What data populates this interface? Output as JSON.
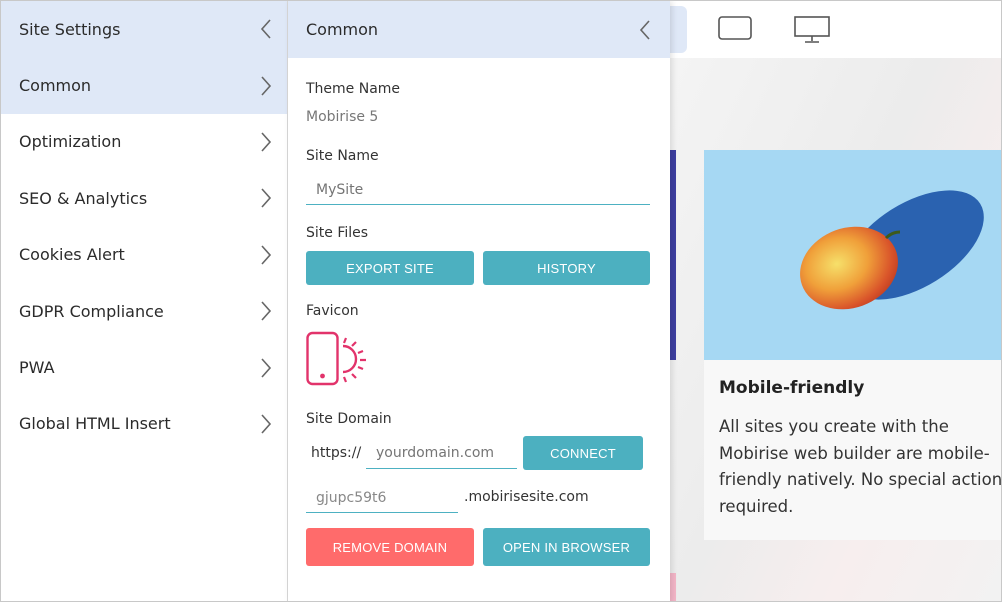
{
  "menu": {
    "header": "Site Settings",
    "items": [
      {
        "label": "Common",
        "active": true
      },
      {
        "label": "Optimization"
      },
      {
        "label": "SEO & Analytics"
      },
      {
        "label": "Cookies Alert"
      },
      {
        "label": "GDPR Compliance"
      },
      {
        "label": "PWA"
      },
      {
        "label": "Global HTML Insert"
      }
    ]
  },
  "panel": {
    "title": "Common",
    "theme_label": "Theme Name",
    "theme_value": "Mobirise 5",
    "site_name_label": "Site Name",
    "site_name_placeholder": "MySite",
    "site_files_label": "Site Files",
    "export_label": "EXPORT SITE",
    "history_label": "HISTORY",
    "favicon_label": "Favicon",
    "domain_label": "Site Domain",
    "https_prefix": "https://",
    "domain_placeholder": "yourdomain.com",
    "connect_label": "CONNECT",
    "subdomain_value": "gjupc59t6",
    "subdomain_suffix": ".mobirisesite.com",
    "remove_label": "REMOVE DOMAIN",
    "browser_label": "OPEN IN BROWSER"
  },
  "preview": {
    "card_title": "Mobile-friendly",
    "card_text": "All sites you create with the Mobirise web builder are mobile-friendly natively. No special actions required."
  },
  "colors": {
    "accent_blue": "#dfe8f7",
    "teal": "#4cb0c0",
    "red": "#ff6b6b",
    "favicon": "#e2336b",
    "card_bg": "#a6d8f3"
  }
}
